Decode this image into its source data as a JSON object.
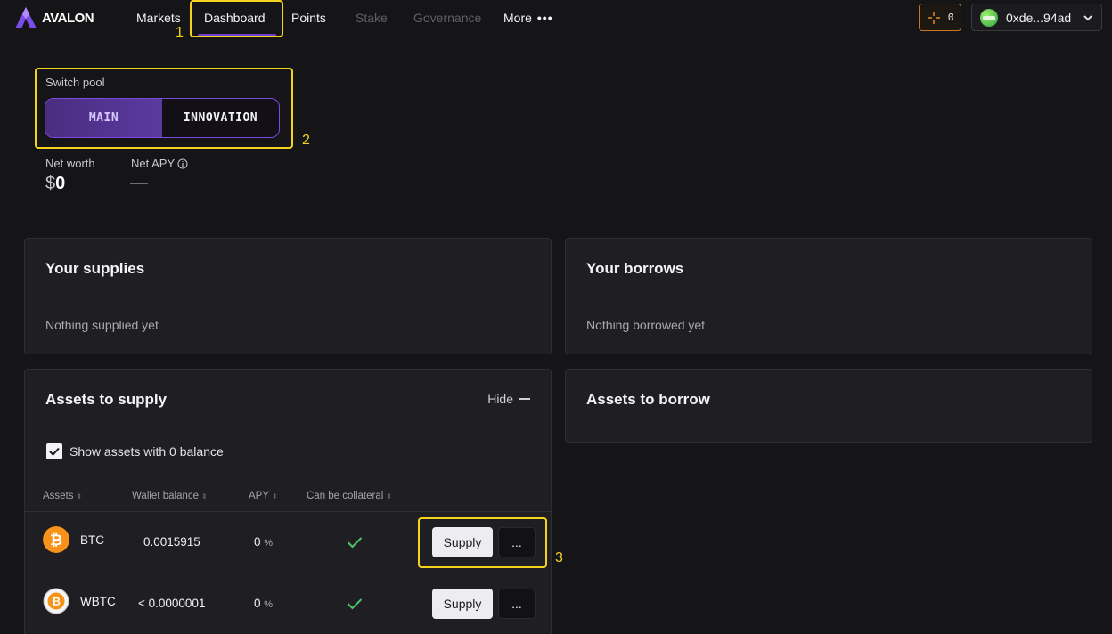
{
  "header": {
    "brand": "AVALON",
    "nav": [
      {
        "label": "Markets",
        "disabled": false
      },
      {
        "label": "Dashboard",
        "disabled": false,
        "active": true
      },
      {
        "label": "Points",
        "disabled": false
      },
      {
        "label": "Stake",
        "disabled": true
      },
      {
        "label": "Governance",
        "disabled": true
      },
      {
        "label": "More",
        "disabled": false
      }
    ],
    "points_count": "0",
    "wallet_address": "0xde...94ad"
  },
  "annotations": [
    "1",
    "2",
    "3"
  ],
  "pool": {
    "label": "Switch pool",
    "options": [
      "MAIN",
      "INNOVATION"
    ],
    "selected": "MAIN"
  },
  "stats": {
    "net_worth_label": "Net worth",
    "net_worth_currency": "$",
    "net_worth_value": "0",
    "net_apy_label": "Net APY",
    "net_apy_value": "—"
  },
  "supplies": {
    "title": "Your supplies",
    "empty": "Nothing supplied yet"
  },
  "borrows": {
    "title": "Your borrows",
    "empty": "Nothing borrowed yet"
  },
  "assets_to_supply": {
    "title": "Assets to supply",
    "hide_label": "Hide",
    "show_zero_label": "Show assets with 0 balance",
    "show_zero_checked": true,
    "columns": [
      "Assets",
      "Wallet balance",
      "APY",
      "Can be collateral"
    ],
    "rows": [
      {
        "asset": "BTC",
        "balance": "0.0015915",
        "apy": "0",
        "apy_unit": "%",
        "collateral": true,
        "supply_label": "Supply",
        "more_label": "..."
      },
      {
        "asset": "WBTC",
        "balance": "< 0.0000001",
        "apy": "0",
        "apy_unit": "%",
        "collateral": true,
        "supply_label": "Supply",
        "more_label": "..."
      }
    ]
  },
  "assets_to_borrow": {
    "title": "Assets to borrow"
  },
  "colors": {
    "accent": "#6d3fd6",
    "highlight": "#f4d21d",
    "check": "#4cc46b",
    "btc": "#f7931a"
  }
}
